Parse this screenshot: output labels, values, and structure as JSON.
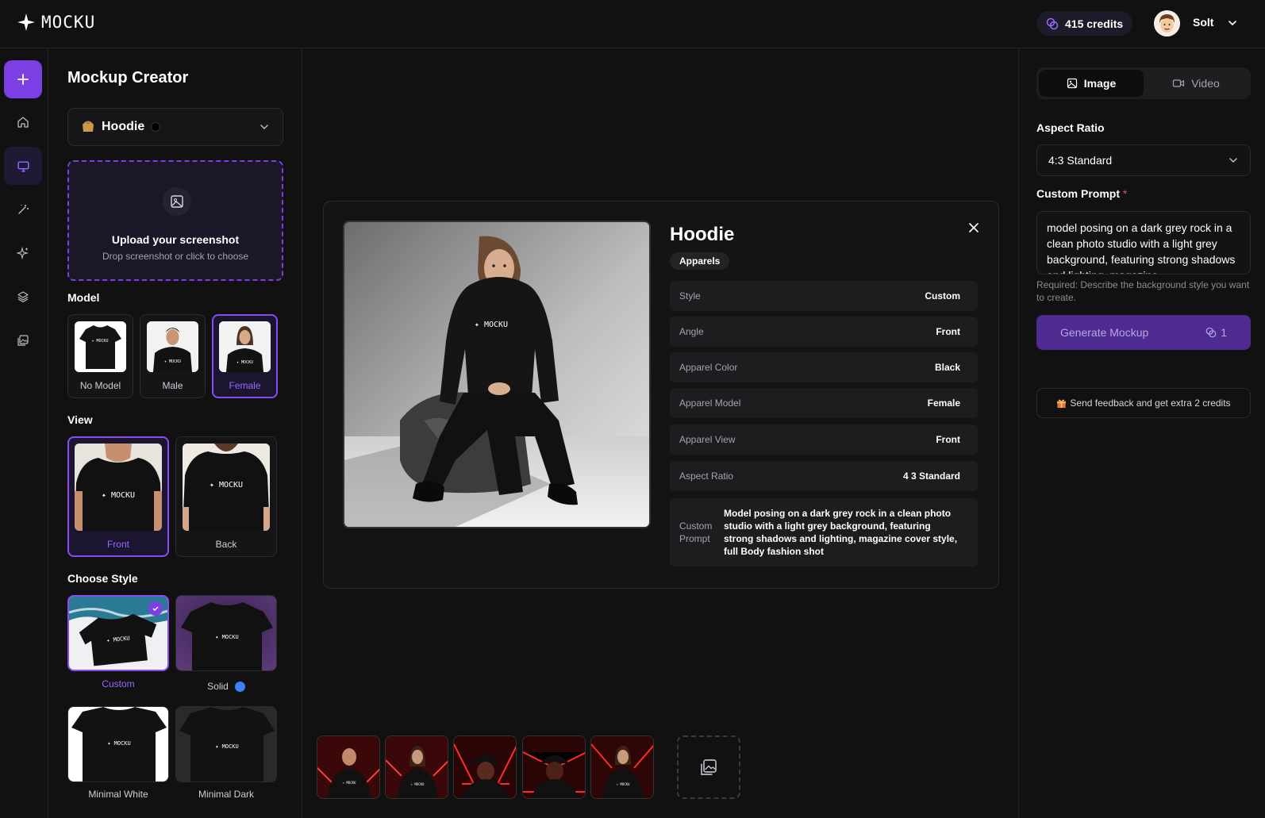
{
  "header": {
    "logo_text": "MOCKU",
    "credits": "415 credits",
    "user_name": "Solt"
  },
  "left": {
    "title": "Mockup Creator",
    "product": "Hoodie",
    "upload_title": "Upload your screenshot",
    "upload_sub": "Drop screenshot or click to choose",
    "model_label": "Model",
    "models": [
      "No Model",
      "Male",
      "Female"
    ],
    "view_label": "View",
    "views": [
      "Front",
      "Back"
    ],
    "style_label": "Choose Style",
    "styles": [
      "Custom",
      "Solid",
      "Minimal White",
      "Minimal Dark"
    ],
    "shirt_print": "MOCKU"
  },
  "detail": {
    "title": "Hoodie",
    "badge": "Apparels",
    "rows": [
      {
        "k": "Style",
        "v": "Custom"
      },
      {
        "k": "Angle",
        "v": "Front"
      },
      {
        "k": "Apparel Color",
        "v": "Black"
      },
      {
        "k": "Apparel Model",
        "v": "Female"
      },
      {
        "k": "Apparel View",
        "v": "Front"
      },
      {
        "k": "Aspect Ratio",
        "v": "4 3 Standard"
      }
    ],
    "prompt_key": "Custom Prompt",
    "prompt_value": "Model posing on a dark grey rock in a clean photo studio with a light grey background, featuring strong shadows and lighting, magazine cover style, full Body fashion shot"
  },
  "right": {
    "tab_image": "Image",
    "tab_video": "Video",
    "aspect_label": "Aspect Ratio",
    "aspect_value": "4:3 Standard",
    "prompt_label": "Custom Prompt",
    "required_mark": "*",
    "prompt_text": "model posing on a dark grey rock in a clean photo studio with a light grey background, featuring strong shadows and lighting, magazine",
    "hint": "Required: Describe the background style you want to create.",
    "generate": "Generate Mockup",
    "cost": "1",
    "feedback": "Send feedback and get extra 2 credits"
  },
  "colors": {
    "accent": "#7b3fe4",
    "selected_border": "#8a4bf0",
    "background": "#111112"
  }
}
